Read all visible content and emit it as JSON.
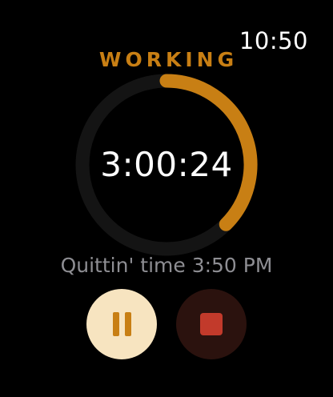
{
  "status_bar": {
    "time": "10:50"
  },
  "session": {
    "state_label": "WORKING",
    "elapsed": "3:00:24",
    "quit_time_text": "Quittin' time 3:50 PM",
    "progress_fraction": 0.375
  },
  "controls": {
    "pause": {
      "icon": "pause-icon"
    },
    "stop": {
      "icon": "stop-icon"
    }
  },
  "colors": {
    "accent": "#c87f14",
    "track": "#141414",
    "pause_bg": "#f7e4c0",
    "pause_glyph": "#c87f14",
    "stop_bg": "#2b120e",
    "stop_glyph": "#c23a2b"
  }
}
